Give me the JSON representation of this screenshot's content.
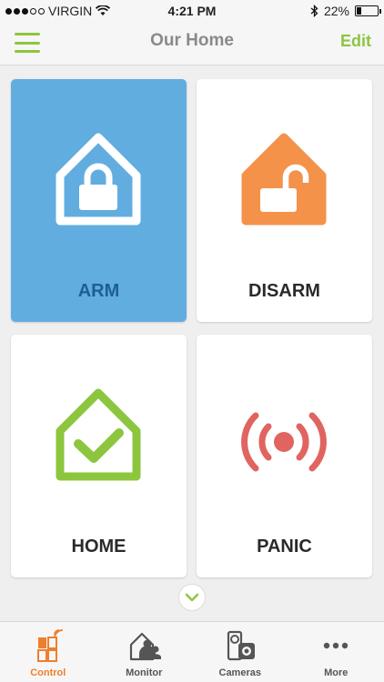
{
  "status_bar": {
    "carrier": "VIRGIN",
    "time": "4:21 PM",
    "battery": "22%",
    "battery_level": 0.22,
    "signal_bars_filled": 3,
    "signal_bars_total": 5,
    "icons": [
      "wifi-icon",
      "bluetooth-icon",
      "battery-icon"
    ]
  },
  "header": {
    "title": "Our Home",
    "edit_label": "Edit",
    "accent_color": "#8cc63f"
  },
  "tiles": [
    {
      "label": "ARM",
      "icon": "house-lock-icon",
      "color": "#ffffff",
      "selected": true
    },
    {
      "label": "DISARM",
      "icon": "house-unlock-icon",
      "color": "#f4924a",
      "selected": false
    },
    {
      "label": "HOME",
      "icon": "house-check-icon",
      "color": "#8cc63f",
      "selected": false
    },
    {
      "label": "PANIC",
      "icon": "alarm-signal-icon",
      "color": "#e06460",
      "selected": false
    }
  ],
  "tab_bar": {
    "tabs": [
      {
        "label": "Control",
        "icon": "control-icon",
        "active": true
      },
      {
        "label": "Monitor",
        "icon": "monitor-icon",
        "active": false
      },
      {
        "label": "Cameras",
        "icon": "cameras-icon",
        "active": false
      },
      {
        "label": "More",
        "icon": "more-icon",
        "active": false
      }
    ],
    "active_color": "#ee7f2d"
  }
}
